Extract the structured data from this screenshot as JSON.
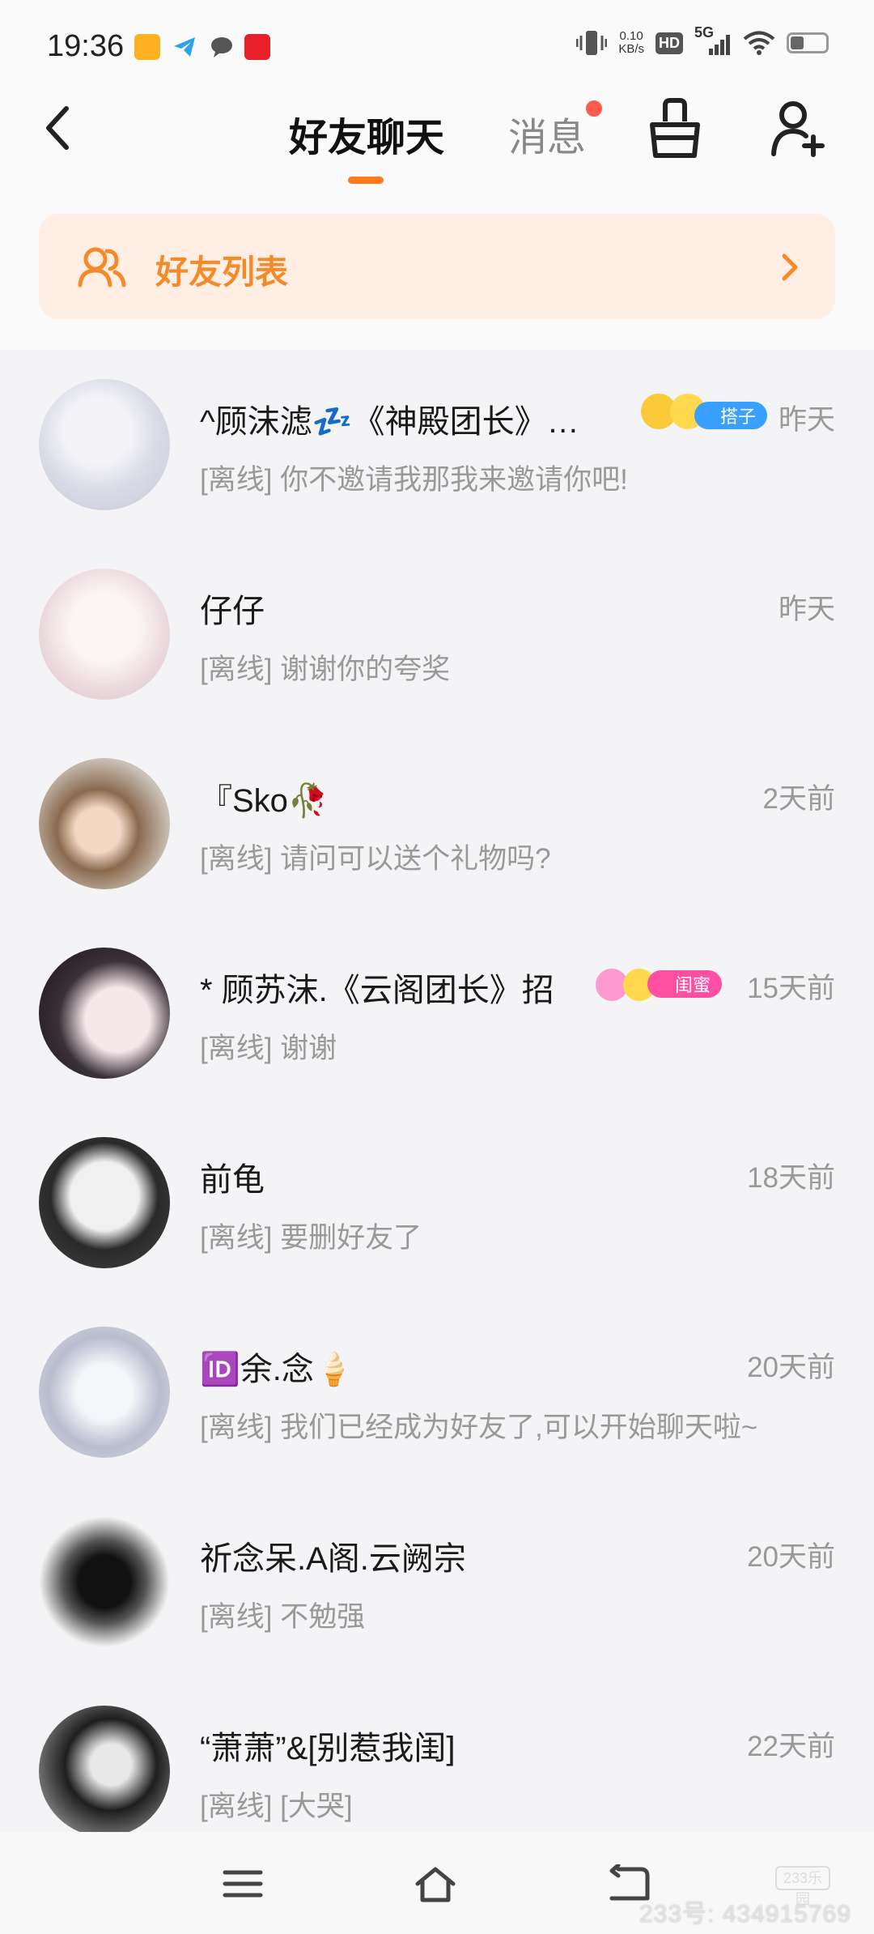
{
  "status_bar": {
    "time": "19:36",
    "net_speed_value": "0.10",
    "net_speed_unit": "KB/s",
    "hd_label": "HD",
    "network_label": "5G"
  },
  "header": {
    "tab_friends_chat": "好友聊天",
    "tab_messages": "消息"
  },
  "friend_list_banner": {
    "label": "好友列表"
  },
  "chats": [
    {
      "name": "^顾沫滤💤《神殿团长》…",
      "time": "昨天",
      "preview": "[离线] 你不邀请我那我来邀请你吧!",
      "badge": "搭子",
      "badge_color": "#3aa0ff"
    },
    {
      "name": "仔仔",
      "time": "昨天",
      "preview": "[离线] 谢谢你的夸奖"
    },
    {
      "name": "『Sko🥀",
      "time": "2天前",
      "preview": "[离线] 请问可以送个礼物吗?"
    },
    {
      "name": " * 顾苏沫.《云阁团长》招",
      "time": "15天前",
      "preview": "[离线] 谢谢",
      "badge": "闺蜜",
      "badge_color": "#ff4fa3"
    },
    {
      "name": "前龟",
      "time": "18天前",
      "preview": "[离线] 要删好友了"
    },
    {
      "name": "🆔余.念🍦",
      "time": "20天前",
      "preview": "[离线] 我们已经成为好友了,可以开始聊天啦~"
    },
    {
      "name": "祈念呆.A阁.云阙宗",
      "time": "20天前",
      "preview": "[离线] 不勉强"
    },
    {
      "name": " “萧萧”&[别惹我闺]",
      "time": "22天前",
      "preview": "[离线] [大哭]"
    }
  ],
  "watermark": {
    "logo": "233乐园",
    "text": "233号: 434915769"
  },
  "colors": {
    "accent": "#ff7a1a",
    "banner_bg": "#ffeee3",
    "banner_text": "#f58a2a",
    "unread_dot": "#ff5a4e"
  }
}
